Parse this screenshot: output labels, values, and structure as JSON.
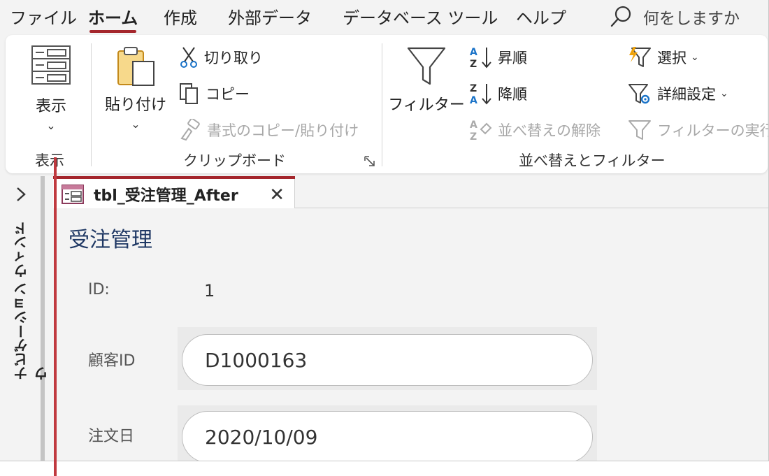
{
  "menu": {
    "tabs": [
      "ファイル",
      "ホーム",
      "作成",
      "外部データ",
      "データベース ツール",
      "ヘルプ"
    ],
    "active": "ホーム",
    "tellme": "何をしますか"
  },
  "ribbon": {
    "view": {
      "button": "表示",
      "group": "表示"
    },
    "clipboard": {
      "paste": "貼り付け",
      "cut": "切り取り",
      "copy": "コピー",
      "format_painter": "書式のコピー/貼り付け",
      "group": "クリップボード"
    },
    "sort_filter": {
      "filter": "フィルター",
      "ascending": "昇順",
      "descending": "降順",
      "clear_sort": "並べ替えの解除",
      "selection": "選択",
      "advanced": "詳細設定",
      "toggle_filter": "フィルターの実行",
      "group": "並べ替えとフィルター"
    }
  },
  "nav_pane": {
    "title": "ナビゲーション ウィンドウ"
  },
  "document": {
    "tab_title": "tbl_受注管理_After",
    "form_title": "受注管理",
    "fields": [
      {
        "label": "ID:",
        "value": "1"
      },
      {
        "label": "顧客ID",
        "value": "D1000163"
      },
      {
        "label": "注文日",
        "value": "2020/10/09"
      }
    ]
  },
  "colors": {
    "accent": "#a4262c",
    "title_text": "#1f3864",
    "marker": "#c0393f"
  }
}
